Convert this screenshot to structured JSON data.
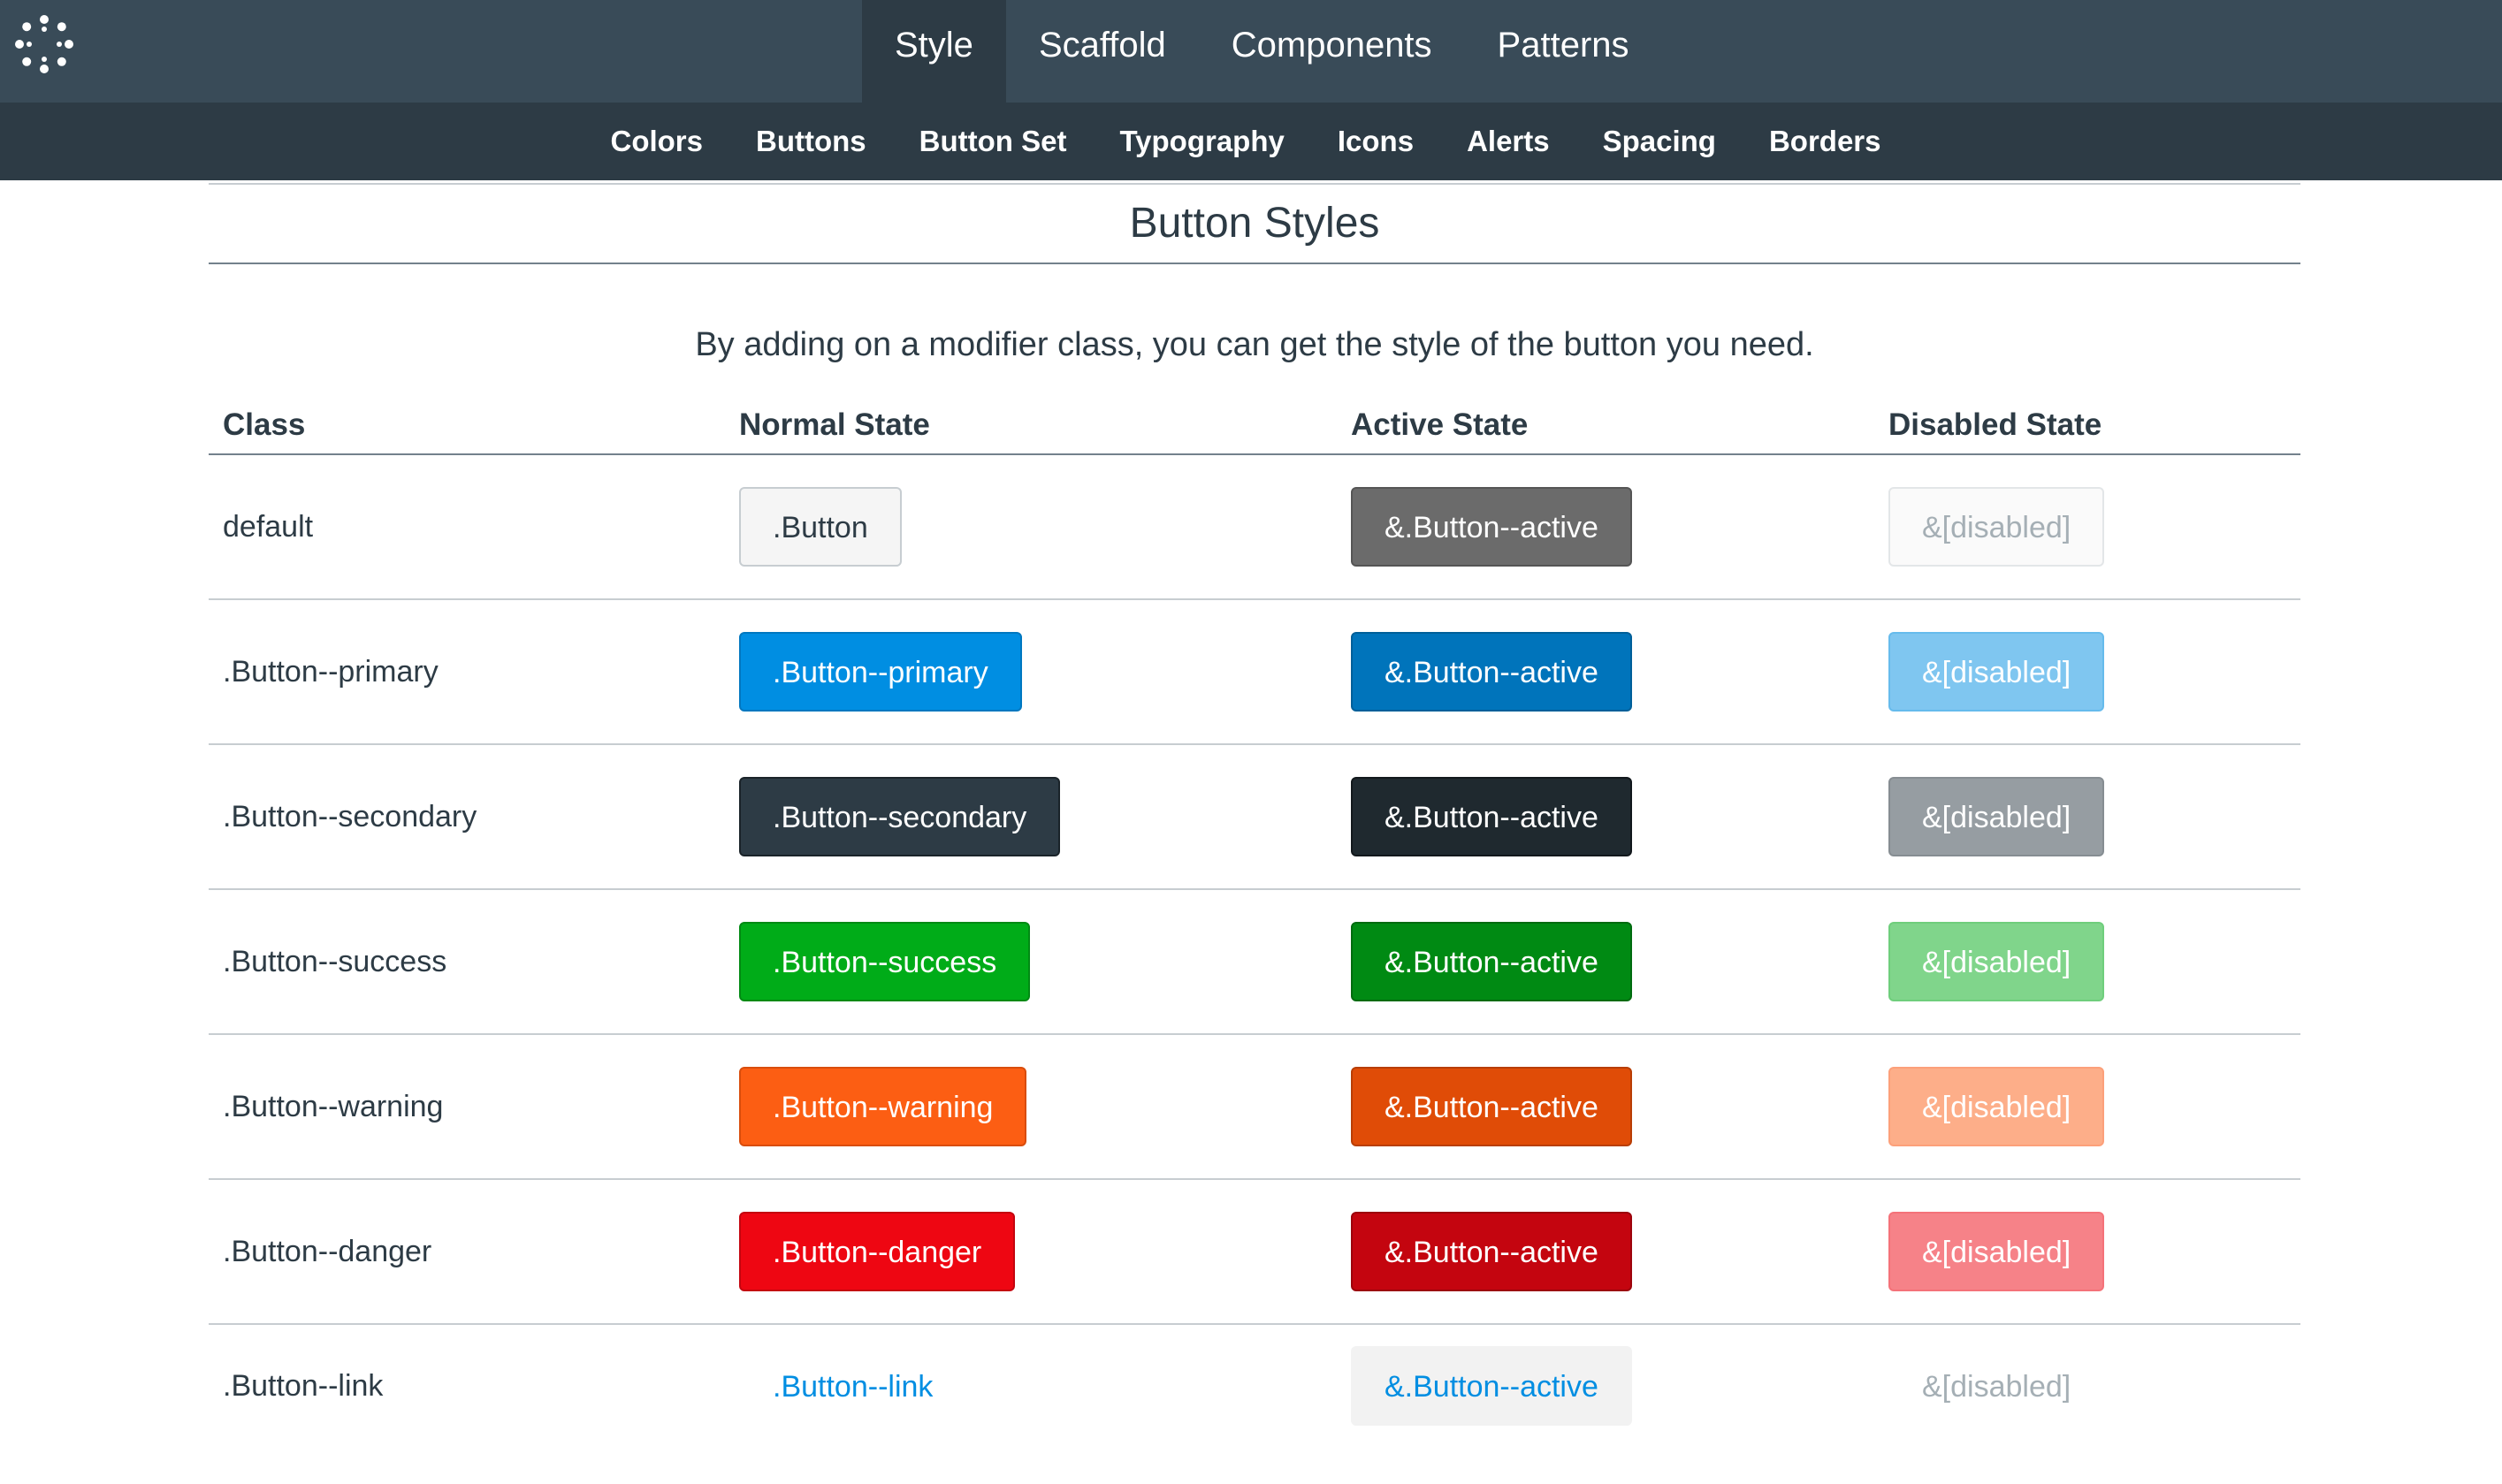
{
  "topnav": {
    "tabs": [
      {
        "label": "Style",
        "active": true
      },
      {
        "label": "Scaffold",
        "active": false
      },
      {
        "label": "Components",
        "active": false
      },
      {
        "label": "Patterns",
        "active": false
      }
    ]
  },
  "subnav": {
    "links": [
      "Colors",
      "Buttons",
      "Button Set",
      "Typography",
      "Icons",
      "Alerts",
      "Spacing",
      "Borders"
    ]
  },
  "section": {
    "title": "Button Styles",
    "intro": "By adding on a modifier class, you can get the style of the button you need."
  },
  "table": {
    "headers": [
      "Class",
      "Normal State",
      "Active State",
      "Disabled State"
    ],
    "rows": [
      {
        "class": "default",
        "normal": {
          "label": ".Button",
          "bg": "#f5f5f5",
          "fg": "#2d3b45",
          "border": "#c7cdd1"
        },
        "active": {
          "label": "&.Button--active",
          "bg": "#6b6b6b",
          "fg": "#ffffff",
          "border": "#555555"
        },
        "disabled": {
          "label": "&[disabled]",
          "bg": "#fafafa",
          "fg": "#a5afb5",
          "border": "#e3e6e8"
        }
      },
      {
        "class": ".Button--primary",
        "normal": {
          "label": ".Button--primary",
          "bg": "#008ee2",
          "fg": "#ffffff",
          "border": "#0077c0"
        },
        "active": {
          "label": "&.Button--active",
          "bg": "#0074bb",
          "fg": "#ffffff",
          "border": "#005f99"
        },
        "disabled": {
          "label": "&[disabled]",
          "bg": "#7fc6f0",
          "fg": "#ffffff",
          "border": "#66bbec"
        }
      },
      {
        "class": ".Button--secondary",
        "normal": {
          "label": ".Button--secondary",
          "bg": "#2d3b45",
          "fg": "#ffffff",
          "border": "#1a2329"
        },
        "active": {
          "label": "&.Button--active",
          "bg": "#1f292f",
          "fg": "#ffffff",
          "border": "#12181c"
        },
        "disabled": {
          "label": "&[disabled]",
          "bg": "#969da2",
          "fg": "#ffffff",
          "border": "#868d92"
        }
      },
      {
        "class": ".Button--success",
        "normal": {
          "label": ".Button--success",
          "bg": "#00ac18",
          "fg": "#ffffff",
          "border": "#008a13"
        },
        "active": {
          "label": "&.Button--active",
          "bg": "#008a13",
          "fg": "#ffffff",
          "border": "#006b0f"
        },
        "disabled": {
          "label": "&[disabled]",
          "bg": "#80d58b",
          "fg": "#ffffff",
          "border": "#6fce7c"
        }
      },
      {
        "class": ".Button--warning",
        "normal": {
          "label": ".Button--warning",
          "bg": "#fc5e13",
          "fg": "#ffffff",
          "border": "#d94d0c"
        },
        "active": {
          "label": "&.Button--active",
          "bg": "#e04c07",
          "fg": "#ffffff",
          "border": "#b83e05"
        },
        "disabled": {
          "label": "&[disabled]",
          "bg": "#fdae89",
          "fg": "#ffffff",
          "border": "#fca07a"
        }
      },
      {
        "class": ".Button--danger",
        "normal": {
          "label": ".Button--danger",
          "bg": "#ee0612",
          "fg": "#ffffff",
          "border": "#c4050f"
        },
        "active": {
          "label": "&.Button--active",
          "bg": "#c4050f",
          "fg": "#ffffff",
          "border": "#9c040c"
        },
        "disabled": {
          "label": "&[disabled]",
          "bg": "#f68288",
          "fg": "#ffffff",
          "border": "#f47279"
        }
      },
      {
        "class": ".Button--link",
        "normal": {
          "label": ".Button--link",
          "bg": "transparent",
          "fg": "#008ee2",
          "border": "transparent"
        },
        "active": {
          "label": "&.Button--active",
          "bg": "#f2f2f2",
          "fg": "#008ee2",
          "border": "#f2f2f2"
        },
        "disabled": {
          "label": "&[disabled]",
          "bg": "transparent",
          "fg": "#a5afb5",
          "border": "transparent"
        }
      }
    ]
  }
}
